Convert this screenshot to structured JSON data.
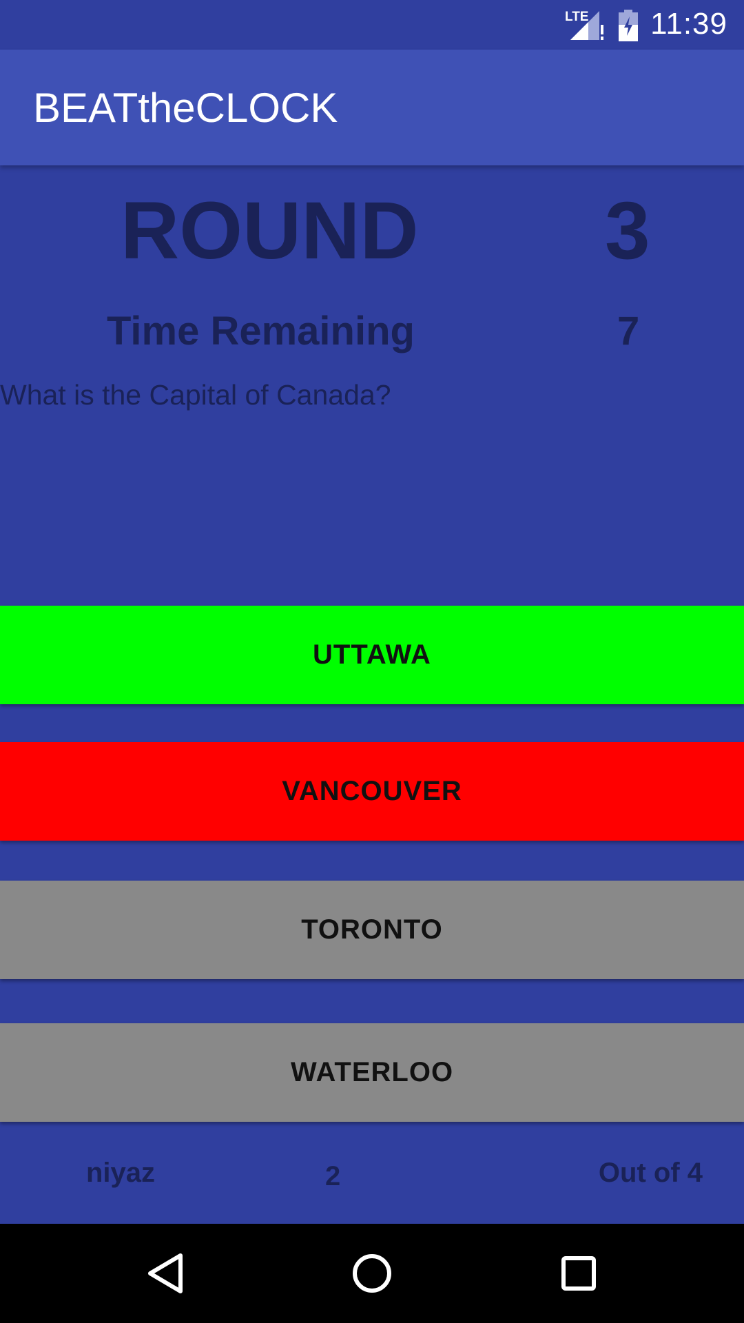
{
  "status_bar": {
    "time": "11:39",
    "network_label": "LTE",
    "icons": [
      "lte-signal-icon",
      "battery-charging-icon"
    ]
  },
  "app_bar": {
    "title": "BEATtheCLOCK"
  },
  "game": {
    "round_label": "ROUND",
    "round_value": "3",
    "time_label": "Time Remaining",
    "time_value": "7",
    "question": "What is the Capital of Canada?"
  },
  "answers": [
    {
      "label": "UTTAWA",
      "color": "#00FF00"
    },
    {
      "label": "VANCOUVER",
      "color": "#FF0000"
    },
    {
      "label": "TORONTO",
      "color": "#898989"
    },
    {
      "label": "WATERLOO",
      "color": "#898989"
    }
  ],
  "footer": {
    "player_name": "niyaz",
    "score": "2",
    "out_of": "Out of 4"
  },
  "nav_bar": {
    "icons": [
      "back-icon",
      "home-icon",
      "recents-icon"
    ]
  },
  "colors": {
    "background": "#303F9F",
    "app_bar": "#3F51B5",
    "text_dark": "#1A2257",
    "nav_bar": "#000000"
  }
}
